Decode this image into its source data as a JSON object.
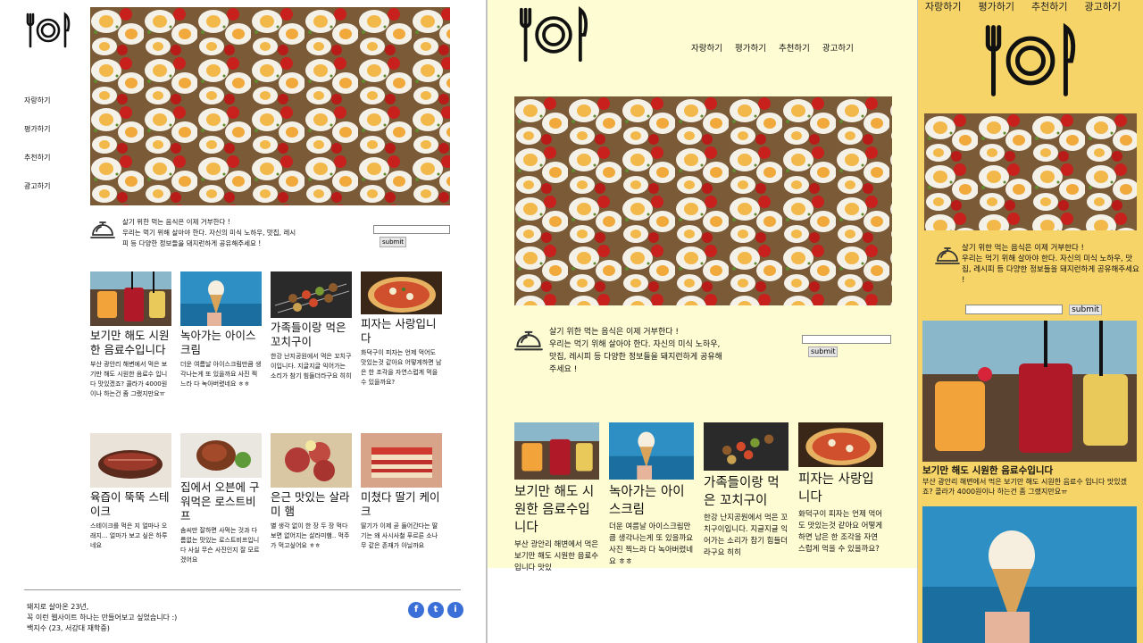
{
  "nav": [
    "자랑하기",
    "평가하기",
    "추천하기",
    "광고하기"
  ],
  "intro": {
    "line1": "살기 위한 먹는 음식은 이제 거부한다 !",
    "line2": "우리는 먹기 위해 살아야 한다. 자신의 미식 노하우, 맛집, 레시피 등 다양한 정보들을 돼지런하게 공유해주세요 !",
    "p2_line2": "우리는 먹기 위해 살아야 한다. 자신의 미식 노하우, 맛집, 레시피 등 다양한 정보들을 돼지런하게 공유해주세요 !",
    "submit_label": "submit"
  },
  "cards": [
    {
      "title": "보기만 해도 시원한 음료수입니다",
      "body": "부산 광안리 해변에서 먹은 보기만 해도 시원한 음료수 입니다 맛있겠죠? 콜라가 4000원이나 하는건 좀 그랬지만요ㅠ",
      "icon": "drink-photo"
    },
    {
      "title": "녹아가는 아이스크림",
      "body": "더운 여름날 아이스크림만큼 생각나는게 또 있을까요 사진 찍느라 다 녹아버렸네요 ㅎㅎ",
      "icon": "icecream-photo"
    },
    {
      "title": "가족들이랑 먹은 꼬치구이",
      "body": "한강 난지공원에서 먹은 꼬치구이입니다. 지글지글 익어가는 소리가 참기 힘들더라구요 히히",
      "icon": "skewer-photo"
    },
    {
      "title": "피자는 사랑입니다",
      "body": "화덕구이 피자는 언제 먹어도 맛있는것 같아요 어떻게하면 남은 한 조각을 자연스럽게 먹을 수 있을까요?",
      "icon": "pizza-photo"
    },
    {
      "title": "육즙이 뚝뚝 스테이크",
      "body": "스테이크를 먹은 지 얼마나 오래지... 얼마가 보고 싶은 하루네요",
      "icon": "steak-photo"
    },
    {
      "title": "집에서 오븐에 구워먹은 로스트비프",
      "body": "솜씨만 잘하면 사먹는 것과 다름없는 맛있는 로스트비프입니다 사실 무슨 사진인지 잘 모르겠어요",
      "icon": "roastbeef-photo"
    },
    {
      "title": "은근 맛있는 살라미 햄",
      "body": "별 생각 없이 한 장 두 장 먹다보면 없어지는 살라미햄.. 먹주가 먹고싶어요 ㅎㅎ",
      "icon": "salami-photo"
    },
    {
      "title": "미쳤다 딸기 케이크",
      "body": "딸기가 이제 곧 들어간다는 딸기는 왜 사시사철 푸르른 소나무 같은 존재가 아닐까요",
      "icon": "cake-photo"
    }
  ],
  "p2_cards": [
    {
      "title": "보기만 해도 시원한 음료수입니다",
      "body": "부산 광안리 해변에서 먹은 보기만 해도 시원한 음료수 입니다 맛있"
    },
    {
      "title": "녹아가는 아이스크림",
      "body": "더운 여름날 아이스크림만큼 생각나는게 또 있을까요 사진 찍느라 다 녹아버렸네요 ㅎㅎ"
    },
    {
      "title": "가족들이랑 먹은 꼬치구이",
      "body": "한강 난지공원에서 먹은 꼬치구이입니다. 지글지글 익어가는 소리가 참기 힘들더라구요 히히"
    },
    {
      "title": "피자는 사랑입니다",
      "body": "화덕구이 피자는 언제 먹어도 맛있는것 같아요 어떻게하면 남은 한 조각을 자연스럽게 먹을 수 있을까요?"
    }
  ],
  "p3_card": {
    "title": "보기만 해도 시원한 음료수입니다",
    "body": "부산 광안리 해변에서 먹은 보기만 해도 시원한 음료수 입니다 맛있겠죠? 콜라가 4000원이나 하는건 좀 그랬지만요ㅠ"
  },
  "footer": {
    "line1": "돼지로 살아온 23년,",
    "line2": "꼭 이런 웹사이트 하나는 만들어보고 싶었습니다 :)",
    "line3": "백지수 (23, 서강대 재학중)"
  },
  "social": {
    "facebook": "f",
    "twitter": "t",
    "instagram": "i"
  },
  "colors": {
    "panel2_bg": "#fdfcd2",
    "panel3_bg": "#f6d468",
    "social": "#3b6fd8"
  }
}
